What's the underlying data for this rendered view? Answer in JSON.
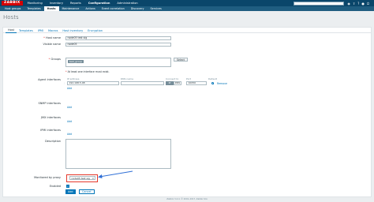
{
  "brand": "ZABBIX",
  "topnav": [
    "Monitoring",
    "Inventory",
    "Reports",
    "Configuration",
    "Administration"
  ],
  "topnav_active": 3,
  "top_icons": [
    "support-icon",
    "share-icon",
    "help-icon",
    "user-icon",
    "power-icon"
  ],
  "subnav": [
    "Host groups",
    "Templates",
    "Hosts",
    "Maintenance",
    "Actions",
    "Event correlation",
    "Discovery",
    "Services"
  ],
  "subnav_active": 2,
  "page_title": "Hosts",
  "tabs": [
    "Host",
    "Templates",
    "IPMI",
    "Macros",
    "Host inventory",
    "Encryption"
  ],
  "form": {
    "host_name_label": "Host name",
    "host_name_value": "node05 test sig",
    "visible_name_label": "Visible name",
    "visible_name_value": "node05",
    "groups_label": "Groups",
    "groups_chip": "test_group",
    "select_label": "Select",
    "groups_hint": "At least one interface must exist.",
    "agent_if_label": "Agent interfaces",
    "if_headers": {
      "ip": "IP address",
      "dns": "DNS name",
      "connect": "Connect to",
      "port": "Port",
      "default": "Default"
    },
    "if_ip_value": "192.168.5.48",
    "if_dns_value": "",
    "if_connect_ip": "IP",
    "if_connect_dns": "DNS",
    "if_port_value": "10050",
    "remove_label": "Remove",
    "add_label": "Add",
    "snmp_label": "SNMP interfaces",
    "jmx_label": "JMX interfaces",
    "ipmi_label": "IPMI interfaces",
    "description_label": "Description",
    "proxy_label": "Monitored by proxy",
    "proxy_value": "node05 test sig",
    "enabled_label": "Enabled",
    "add_button": "Add",
    "cancel_button": "Cancel"
  },
  "footer": "Zabbix 3.4.4. © 2001–2017, Zabbix SIA"
}
